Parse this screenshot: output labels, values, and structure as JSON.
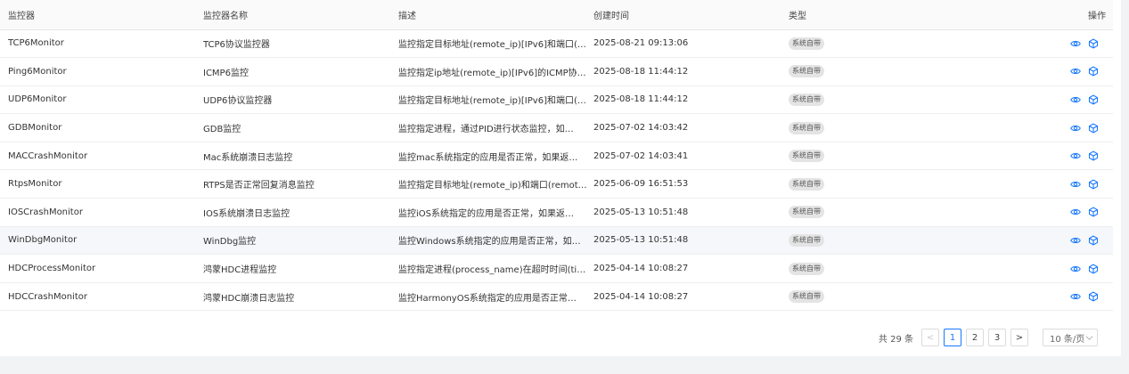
{
  "columns": {
    "monitor": "监控器",
    "name": "监控器名称",
    "description": "描述",
    "created": "创建时间",
    "type": "类型",
    "actions": "操作"
  },
  "rows": [
    {
      "monitor": "TCP6Monitor",
      "name": "TCP6协议监控器",
      "description": "监控指定目标地址(remote_ip)[IPv6]和端口(…",
      "created": "2025-08-21 09:13:06",
      "type": "系统自带"
    },
    {
      "monitor": "Ping6Monitor",
      "name": "ICMP6监控",
      "description": "监控指定ip地址(remote_ip)[IPv6]的ICMP协…",
      "created": "2025-08-18 11:44:12",
      "type": "系统自带"
    },
    {
      "monitor": "UDP6Monitor",
      "name": "UDP6协议监控器",
      "description": "监控指定目标地址(remote_ip)[IPv6]和端口(…",
      "created": "2025-08-18 11:44:12",
      "type": "系统自带"
    },
    {
      "monitor": "GDBMonitor",
      "name": "GDB监控",
      "description": "监控指定进程，通过PID进行状态监控，如…",
      "created": "2025-07-02 14:03:42",
      "type": "系统自带"
    },
    {
      "monitor": "MACCrashMonitor",
      "name": "Mac系统崩溃日志监控",
      "description": "监控mac系统指定的应用是否正常，如果返…",
      "created": "2025-07-02 14:03:41",
      "type": "系统自带"
    },
    {
      "monitor": "RtpsMonitor",
      "name": "RTPS是否正常回复消息监控",
      "description": "监控指定目标地址(remote_ip)和端口(remot…",
      "created": "2025-06-09 16:51:53",
      "type": "系统自带"
    },
    {
      "monitor": "IOSCrashMonitor",
      "name": "IOS系统崩溃日志监控",
      "description": "监控iOS系统指定的应用是否正常，如果返…",
      "created": "2025-05-13 10:51:48",
      "type": "系统自带"
    },
    {
      "monitor": "WinDbgMonitor",
      "name": "WinDbg监控",
      "description": "监控Windows系统指定的应用是否正常，如…",
      "created": "2025-05-13 10:51:48",
      "type": "系统自带"
    },
    {
      "monitor": "HDCProcessMonitor",
      "name": "鸿蒙HDC进程监控",
      "description": "监控指定进程(process_name)在超时时间(ti…",
      "created": "2025-04-14 10:08:27",
      "type": "系统自带"
    },
    {
      "monitor": "HDCCrashMonitor",
      "name": "鸿蒙HDC崩溃日志监控",
      "description": "监控HarmonyOS系统指定的应用是否正常…",
      "created": "2025-04-14 10:08:27",
      "type": "系统自带"
    }
  ],
  "icons": {
    "view": "eye-icon",
    "detail": "cube-icon",
    "accent": "#1677ff"
  },
  "pagination": {
    "total": "共 29 条",
    "prev": "<",
    "pages": [
      "1",
      "2",
      "3"
    ],
    "current": "1",
    "next": ">",
    "page_size": "10 条/页"
  }
}
